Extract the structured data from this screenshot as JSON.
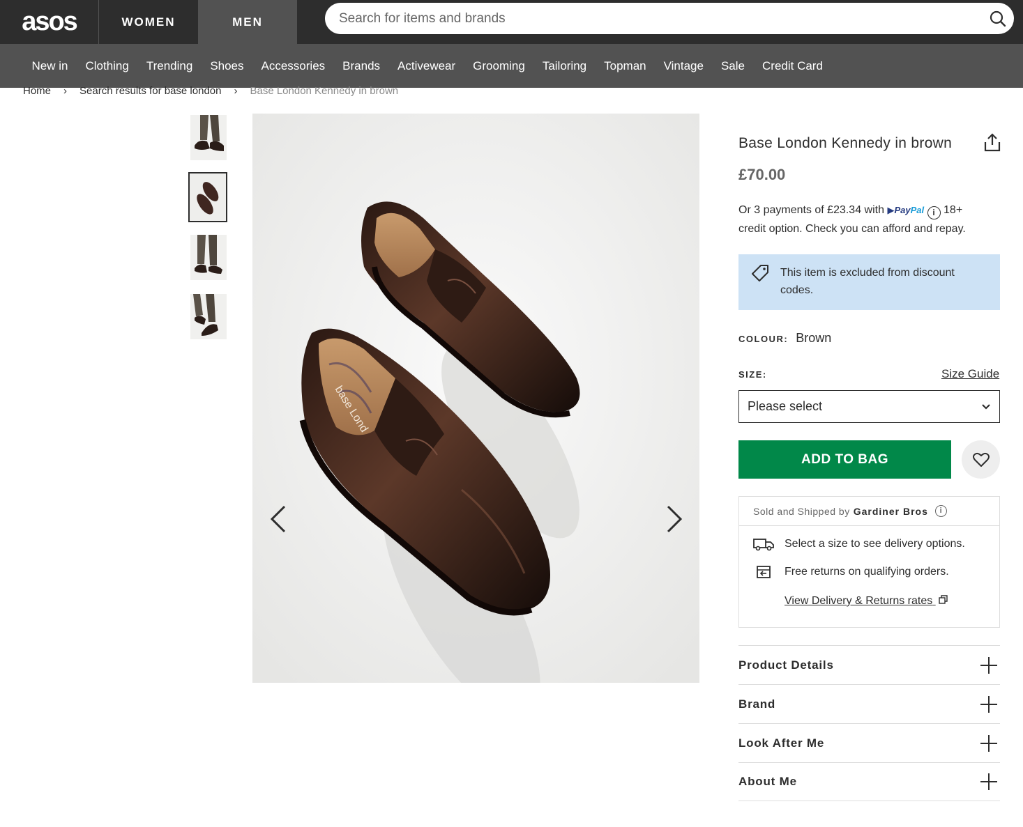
{
  "header": {
    "logo": "asos",
    "gender_tabs": [
      "WOMEN",
      "MEN"
    ],
    "active_tab": "MEN",
    "search_placeholder": "Search for items and brands"
  },
  "nav": [
    "New in",
    "Clothing",
    "Trending",
    "Shoes",
    "Accessories",
    "Brands",
    "Activewear",
    "Grooming",
    "Tailoring",
    "Topman",
    "Vintage",
    "Sale",
    "Credit Card"
  ],
  "breadcrumb": {
    "home": "Home",
    "search": "Search results for base london",
    "current": "Base London Kennedy in brown",
    "sep": "›"
  },
  "product": {
    "title": "Base London Kennedy in brown",
    "price": "£70.00",
    "paypal_line1": "Or 3 payments of £23.34 with",
    "paypal_brand_a": "Pay",
    "paypal_brand_b": "Pal",
    "paypal_age": "18+",
    "paypal_line2": "credit option. Check you can afford and repay.",
    "discount_notice": "This item is excluded from discount codes.",
    "colour_label": "COLOUR:",
    "colour_value": "Brown",
    "size_label": "SIZE:",
    "size_guide": "Size Guide",
    "size_select": "Please select",
    "add_to_bag": "ADD TO BAG",
    "insole_print": "base Lond"
  },
  "delivery": {
    "sold_by_prefix": "Sold and Shipped by",
    "seller": "Gardiner Bros",
    "size_delivery": "Select a size to see delivery options.",
    "returns": "Free returns on qualifying orders.",
    "rates_link": "View Delivery & Returns rates"
  },
  "accordion": [
    "Product Details",
    "Brand",
    "Look After Me",
    "About Me"
  ],
  "colors": {
    "header_bg": "#2d2d2d",
    "nav_bg": "#525252",
    "add_to_bag": "#018849",
    "discount_bg": "#cde2f5",
    "shoe_brown": "#3f2620"
  }
}
